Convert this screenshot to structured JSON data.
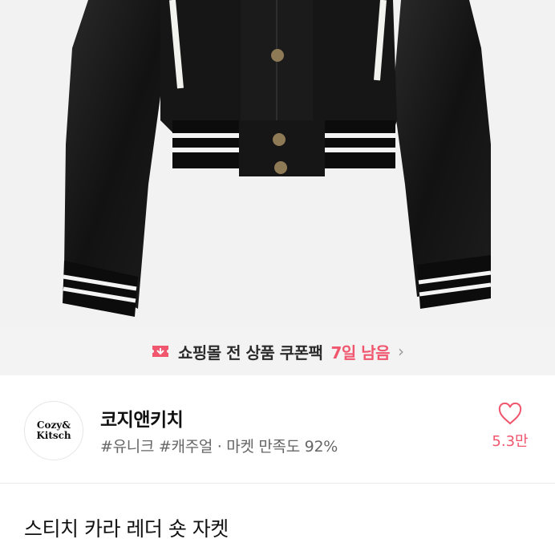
{
  "product_image": {
    "alt": "jacket-photo"
  },
  "coupon_banner": {
    "text": "쇼핑몰 전 상품 쿠폰팩",
    "days_left": "7일 남음",
    "icon": "coupon-ticket-icon",
    "accent_color": "#f0566e"
  },
  "shop": {
    "logo_line1": "Cozy&",
    "logo_line2": "Kitsch",
    "name": "코지앤키치",
    "tags": "#유니크 #캐주얼 · 마켓 만족도 92%",
    "likes": "5.3만",
    "like_icon": "heart-outline-icon"
  },
  "product": {
    "title": "스티치 카라 레더 숏 자켓"
  }
}
